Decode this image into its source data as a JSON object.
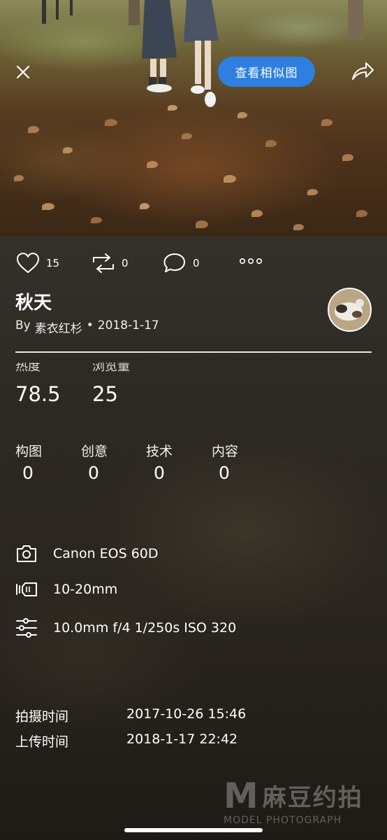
{
  "header": {
    "similar_button_label": "查看相似图"
  },
  "actions": {
    "likes": "15",
    "reposts": "0",
    "comments": "0"
  },
  "post": {
    "title": "秋天",
    "by": "By",
    "author": "素衣红杉",
    "separator": "•",
    "date": "2018-1-17"
  },
  "stats": {
    "heat_label": "热度",
    "heat_value": "78.5",
    "views_label": "浏览量",
    "views_value": "25"
  },
  "scores": [
    {
      "label": "构图",
      "value": "0"
    },
    {
      "label": "创意",
      "value": "0"
    },
    {
      "label": "技术",
      "value": "0"
    },
    {
      "label": "内容",
      "value": "0"
    }
  ],
  "specs": {
    "camera": "Canon EOS 60D",
    "lens": "10-20mm",
    "settings": "10.0mm f/4 1/250s ISO 320"
  },
  "times": {
    "shot_label": "拍摄时间",
    "shot_value": "2017-10-26 15:46",
    "upload_label": "上传时间",
    "upload_value": "2018-1-17 22:42"
  },
  "watermark": {
    "logo_letter": "M",
    "logo_cn": "麻豆约拍",
    "logo_en": "MODEL PHOTOGRAPH"
  },
  "colors": {
    "accent": "#2f7fe0"
  }
}
